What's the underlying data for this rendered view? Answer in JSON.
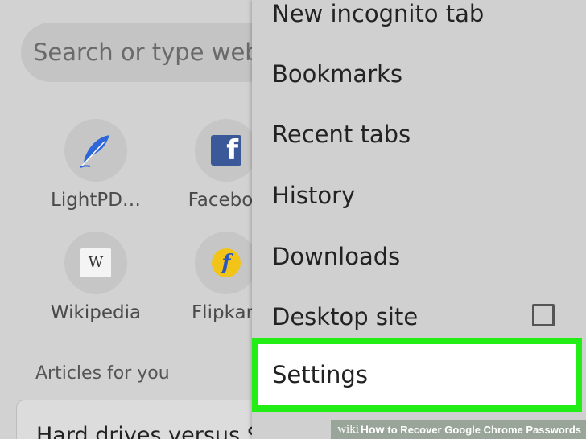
{
  "search": {
    "placeholder_visible": "Search or type web"
  },
  "shortcuts": [
    {
      "label": "LightPD…",
      "icon": "feather-icon"
    },
    {
      "label": "Faceboo",
      "icon": "facebook-icon"
    },
    {
      "label": "Wikipedia",
      "icon": "wikipedia-icon"
    },
    {
      "label": "Flipkart",
      "icon": "flipkart-icon"
    }
  ],
  "icons": {
    "facebook_glyph": "f",
    "wikipedia_glyph": "W",
    "flipkart_glyph": "f"
  },
  "articles": {
    "heading": "Articles for you",
    "first_title": "Hard drives versus SSD"
  },
  "menu": {
    "items": [
      {
        "label": "New incognito tab"
      },
      {
        "label": "Bookmarks"
      },
      {
        "label": "Recent tabs"
      },
      {
        "label": "History"
      },
      {
        "label": "Downloads"
      },
      {
        "label": "Desktop site",
        "checkbox": false
      }
    ],
    "settings_label": "Settings",
    "highlight_color": "#22ee16"
  },
  "watermark": {
    "brand": "wiki",
    "how": "How",
    "title": "to Recover Google Chrome Passwords"
  }
}
